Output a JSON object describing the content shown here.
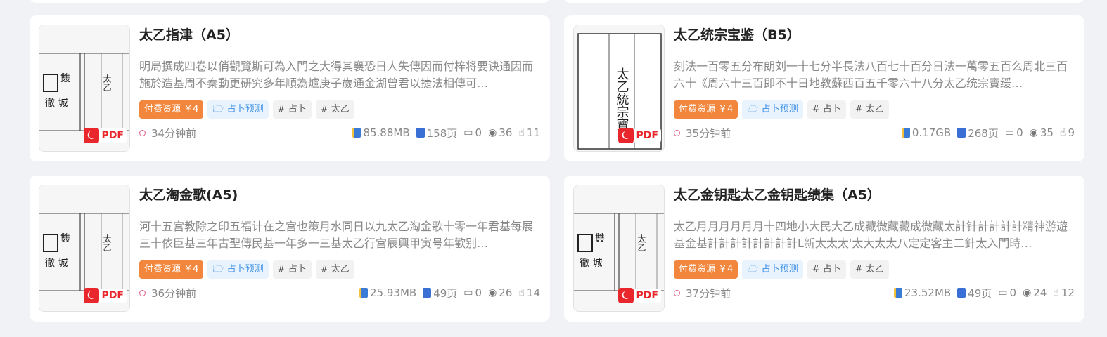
{
  "cards": [
    {
      "title": "太乙指津（A5）",
      "desc": "明局撰成四卷以俏觀覽斯可為入門之大得其襄恐日人失傳因而付梓将要诀通因而施於造基周不秦動更研究多年順為爐庚子歲通金湖曾君以捷法相傳可…",
      "tags": {
        "paid": "付费资源 ￥4",
        "category": "🗁 占卜预测",
        "tag1": "# 占卜",
        "tag2": "# 太乙"
      },
      "time": "34分钟前",
      "size": "85.88MB",
      "pages": "158页",
      "comments": "0",
      "views": "36",
      "likes": "11",
      "pdf": "PDF"
    },
    {
      "title": "太乙统宗宝鉴（B5）",
      "desc": "刻法一百零五分布朗刘一十七分半長法八百七十百分日法一萬零五百么周北三百六十《周六十三百即不十日地教蘇西百五千零六十八分太乙统宗寶缓…",
      "tags": {
        "paid": "付费资源 ￥4",
        "category": "🗁 占卜预测",
        "tag1": "# 占卜",
        "tag2": "# 太乙"
      },
      "time": "35分钟前",
      "size": "0.17GB",
      "pages": "268页",
      "comments": "0",
      "views": "35",
      "likes": "9",
      "pdf": "PDF"
    },
    {
      "title": "太乙淘金歌(A5)",
      "desc": "河十五宫教除之印五福计在之宫也策月水同日以九太乙淘金歌十零一年君基每展三十依臣基三年古聖傳民基一年多一三基太乙行宫辰興甲寅号年歡别…",
      "tags": {
        "paid": "付费资源 ￥4",
        "category": "🗁 占卜预测",
        "tag1": "# 占卜",
        "tag2": "# 太乙"
      },
      "time": "36分钟前",
      "size": "25.93MB",
      "pages": "49页",
      "comments": "0",
      "views": "26",
      "likes": "14",
      "pdf": "PDF"
    },
    {
      "title": "太乙金钥匙太乙金钥匙绩集（A5）",
      "desc": "太乙月月月月月月十四地小大民大乙成藏微藏藏成微藏太計针計計計計精神游遊基金基計計計計計計計計L新太太太'太大太太八定定客主二針太入門時…",
      "tags": {
        "paid": "付费资源 ￥4",
        "category": "🗁 占卜预测",
        "tag1": "# 占卜",
        "tag2": "# 太乙"
      },
      "time": "37分钟前",
      "size": "23.52MB",
      "pages": "49页",
      "comments": "0",
      "views": "24",
      "likes": "12",
      "pdf": "PDF"
    }
  ],
  "icons": {
    "time": "clock-circle-icon",
    "size": "file-size-icon",
    "pages": "pages-icon",
    "comments": "comment-icon",
    "views": "eye-icon",
    "likes": "thumbs-up-icon"
  }
}
